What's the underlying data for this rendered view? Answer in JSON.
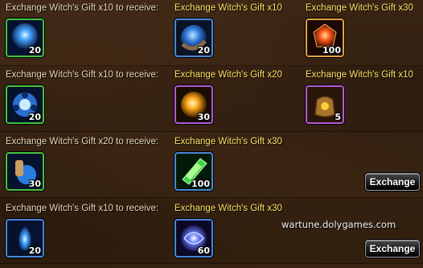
{
  "rows": [
    {
      "requirement": "Exchange Witch's Gift x10 to receive:",
      "required_item": {
        "icon": "blue-orb-icon",
        "quantity": "20"
      },
      "rewards": [
        {
          "label": "Exchange Witch's Gift x10",
          "icon": "blue-crescent-orb-icon",
          "quantity": "20"
        },
        {
          "label": "Exchange Witch's Gift x30",
          "icon": "red-gem-icon",
          "quantity": "100"
        }
      ],
      "button": null
    },
    {
      "requirement": "Exchange Witch's Gift x10 to receive:",
      "required_item": {
        "icon": "blue-gear-icon",
        "quantity": "20"
      },
      "rewards": [
        {
          "label": "Exchange Witch's Gift x20",
          "icon": "golden-orb-icon",
          "quantity": "30"
        },
        {
          "label": "Exchange Witch's Gift x10",
          "icon": "treasure-pouch-icon",
          "quantity": "5"
        }
      ],
      "button": null
    },
    {
      "requirement": "Exchange Witch's Gift x20 to receive:",
      "required_item": {
        "icon": "blue-scroll-icon",
        "quantity": "30"
      },
      "rewards": [
        {
          "label": "Exchange Witch's Gift x30",
          "icon": "green-crystal-icon",
          "quantity": "100"
        }
      ],
      "button": "Exchange"
    },
    {
      "requirement": "Exchange Witch's Gift x10 to receive:",
      "required_item": {
        "icon": "blue-flame-icon",
        "quantity": "20"
      },
      "rewards": [
        {
          "label": "Exchange Witch's Gift x30",
          "icon": "swirl-orb-icon",
          "quantity": "60"
        }
      ],
      "button": "Exchange"
    }
  ],
  "watermark": "wartune.dolygames.com",
  "colors": {
    "label_yellow": "#ffe266",
    "label_white": "#e8d9b5",
    "background": "#33210f"
  }
}
